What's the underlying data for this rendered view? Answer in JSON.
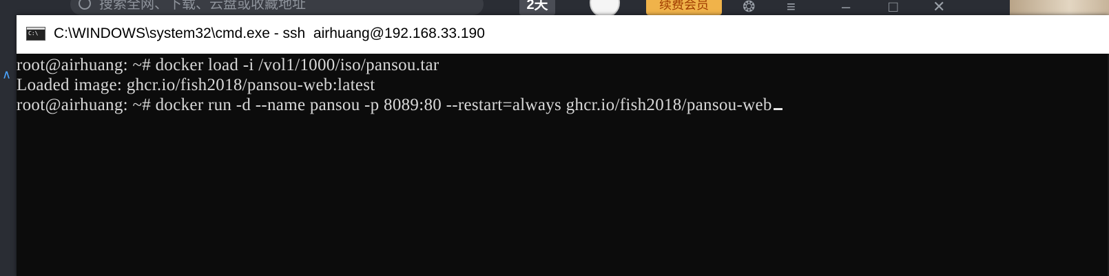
{
  "background_app": {
    "search_placeholder": "搜索全网、下载、云盘或收藏地址",
    "days_badge": "2天",
    "vip_badge": "续费会员",
    "icons": [
      "search-icon",
      "avatar-icon",
      "notification-icon",
      "menu-icon",
      "minimize-icon",
      "maximize-icon",
      "close-icon"
    ]
  },
  "console": {
    "title": "C:\\WINDOWS\\system32\\cmd.exe - ssh  airhuang@192.168.33.190",
    "lines": [
      "root@airhuang: ~# docker load -i /vol1/1000/iso/pansou.tar",
      "Loaded image: ghcr.io/fish2018/pansou-web:latest",
      "root@airhuang: ~# docker run -d --name pansou -p 8089:80 --restart=always ghcr.io/fish2018/pansou-web"
    ],
    "colors": {
      "background": "#0c0c0c",
      "foreground": "#d8d8d8",
      "titlebar": "#ffffff"
    }
  }
}
